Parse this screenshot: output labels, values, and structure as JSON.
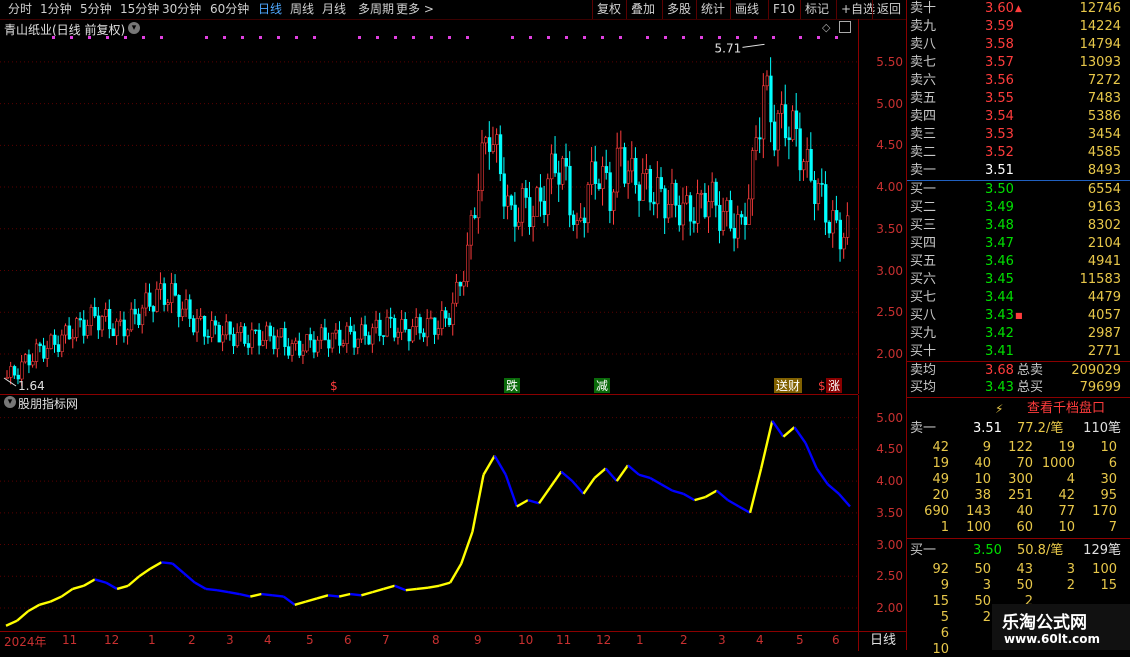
{
  "toolbar": {
    "periods": [
      "分时",
      "1分钟",
      "5分钟",
      "15分钟",
      "30分钟",
      "60分钟",
      "日线",
      "周线",
      "月线",
      "多周期",
      "更多"
    ],
    "active_period": "日线",
    "more_arrow": ">",
    "actions": [
      "复权",
      "叠加",
      "多股",
      "统计",
      "画线",
      "F10",
      "标记",
      "+自选",
      "返回"
    ]
  },
  "main_chart": {
    "title": "青山纸业(日线 前复权)",
    "y_ticks": [
      "5.50",
      "5.00",
      "4.50",
      "4.00",
      "3.50",
      "3.00",
      "2.50",
      "2.00"
    ],
    "high_label": "5.71",
    "low_label": "1.64",
    "event_markers": [
      "$",
      "跌",
      "减",
      "送财",
      "$",
      "涨"
    ]
  },
  "indicator": {
    "title": "股朋指标网",
    "y_ticks": [
      "5.00",
      "4.50",
      "4.00",
      "3.50",
      "3.00",
      "2.50",
      "2.00"
    ]
  },
  "x_axis": {
    "labels": [
      "2024年",
      "11",
      "12",
      "1",
      "2",
      "3",
      "4",
      "5",
      "6",
      "7",
      "8",
      "9",
      "10",
      "11",
      "12",
      "1",
      "2",
      "3",
      "4",
      "5",
      "6"
    ],
    "period_label": "日线"
  },
  "chart_data": [
    {
      "type": "candlestick",
      "title": "青山纸业(日线 前复权)",
      "ylim": [
        1.7,
        5.75
      ],
      "y_ticks": [
        2.0,
        2.5,
        3.0,
        3.5,
        4.0,
        4.5,
        5.0,
        5.5
      ],
      "close_series": [
        1.72,
        1.8,
        1.95,
        2.05,
        2.1,
        2.18,
        2.3,
        2.35,
        2.45,
        2.4,
        2.3,
        2.35,
        2.5,
        2.62,
        2.72,
        2.7,
        2.55,
        2.4,
        2.3,
        2.28,
        2.25,
        2.22,
        2.18,
        2.22,
        2.2,
        2.18,
        2.05,
        2.1,
        2.15,
        2.2,
        2.18,
        2.22,
        2.2,
        2.25,
        2.3,
        2.35,
        2.28,
        2.3,
        2.32,
        2.35,
        2.4,
        2.7,
        3.2,
        4.1,
        4.7,
        4.2,
        3.6,
        3.8,
        3.7,
        3.9,
        4.3,
        4.1,
        3.4,
        4.0,
        4.2,
        3.9,
        4.4,
        4.1,
        4.05,
        3.95,
        3.85,
        3.8,
        3.7,
        3.75,
        3.9,
        3.7,
        3.6,
        3.5,
        4.2,
        5.2,
        4.7,
        4.8,
        4.6,
        4.2,
        3.95,
        3.6,
        3.45
      ],
      "max": 5.71,
      "min": 1.64
    },
    {
      "type": "line",
      "title": "股朋指标网",
      "ylim": [
        1.7,
        5.2
      ],
      "y_ticks": [
        2.0,
        2.5,
        3.0,
        3.5,
        4.0,
        4.5,
        5.0
      ],
      "series": [
        {
          "values": [
            1.72,
            1.8,
            1.95,
            2.05,
            2.1,
            2.18,
            2.3,
            2.35,
            2.45,
            2.4,
            2.3,
            2.35,
            2.5,
            2.62,
            2.72,
            2.7,
            2.55,
            2.4,
            2.3,
            2.28,
            2.25,
            2.22,
            2.18,
            2.22,
            2.2,
            2.18,
            2.05,
            2.1,
            2.15,
            2.2,
            2.18,
            2.22,
            2.2,
            2.25,
            2.3,
            2.35,
            2.28,
            2.3,
            2.32,
            2.35,
            2.4,
            2.7,
            3.2,
            4.1,
            4.4,
            4.1,
            3.6,
            3.7,
            3.65,
            3.9,
            4.15,
            4.0,
            3.8,
            4.05,
            4.2,
            4.0,
            4.25,
            4.1,
            4.05,
            3.95,
            3.85,
            3.8,
            3.7,
            3.75,
            3.85,
            3.7,
            3.6,
            3.5,
            4.2,
            4.95,
            4.7,
            4.85,
            4.6,
            4.2,
            3.95,
            3.8,
            3.6
          ]
        }
      ],
      "colors": {
        "up": "#ffff00",
        "down": "#0000ff"
      }
    }
  ],
  "order_book": {
    "sells": [
      {
        "label": "卖十",
        "price": "3.60",
        "vol": "12746",
        "mark": "▲"
      },
      {
        "label": "卖九",
        "price": "3.59",
        "vol": "14224"
      },
      {
        "label": "卖八",
        "price": "3.58",
        "vol": "14794"
      },
      {
        "label": "卖七",
        "price": "3.57",
        "vol": "13093"
      },
      {
        "label": "卖六",
        "price": "3.56",
        "vol": "7272"
      },
      {
        "label": "卖五",
        "price": "3.55",
        "vol": "7483"
      },
      {
        "label": "卖四",
        "price": "3.54",
        "vol": "5386"
      },
      {
        "label": "卖三",
        "price": "3.53",
        "vol": "3454"
      },
      {
        "label": "卖二",
        "price": "3.52",
        "vol": "4585"
      },
      {
        "label": "卖一",
        "price": "3.51",
        "vol": "8493"
      }
    ],
    "buys": [
      {
        "label": "买一",
        "price": "3.50",
        "vol": "6554"
      },
      {
        "label": "买二",
        "price": "3.49",
        "vol": "9163"
      },
      {
        "label": "买三",
        "price": "3.48",
        "vol": "8302"
      },
      {
        "label": "买四",
        "price": "3.47",
        "vol": "2104"
      },
      {
        "label": "买五",
        "price": "3.46",
        "vol": "4941"
      },
      {
        "label": "买六",
        "price": "3.45",
        "vol": "11583"
      },
      {
        "label": "买七",
        "price": "3.44",
        "vol": "4479"
      },
      {
        "label": "买八",
        "price": "3.43",
        "vol": "4057",
        "mark": "■"
      },
      {
        "label": "买九",
        "price": "3.42",
        "vol": "2987"
      },
      {
        "label": "买十",
        "price": "3.41",
        "vol": "2771"
      }
    ],
    "avg_sell": {
      "label": "卖均",
      "price": "3.68",
      "total_label": "总卖",
      "total": "209029"
    },
    "avg_buy": {
      "label": "买均",
      "price": "3.43",
      "total_label": "总买",
      "total": "79699"
    },
    "link_icon": "lightning-icon",
    "link_text": "查看千档盘口",
    "sell1": {
      "label": "卖一",
      "price": "3.51",
      "avg": "77.2/笔",
      "count": "110笔"
    },
    "sell_grid": [
      [
        "42",
        "9",
        "122",
        "19",
        "10"
      ],
      [
        "19",
        "40",
        "70",
        "1000",
        "6"
      ],
      [
        "49",
        "10",
        "300",
        "4",
        "30"
      ],
      [
        "20",
        "38",
        "251",
        "42",
        "95"
      ],
      [
        "690",
        "143",
        "40",
        "77",
        "170"
      ],
      [
        "1",
        "100",
        "60",
        "10",
        "7"
      ]
    ],
    "buy1": {
      "label": "买一",
      "price": "3.50",
      "avg": "50.8/笔",
      "count": "129笔"
    },
    "buy_grid": [
      [
        "92",
        "50",
        "43",
        "3",
        "100"
      ],
      [
        "9",
        "3",
        "50",
        "2",
        "15"
      ],
      [
        "15",
        "50",
        "2",
        "",
        ""
      ],
      [
        "5",
        "2",
        "",
        "",
        ""
      ],
      [
        "6",
        "",
        "",
        "",
        ""
      ],
      [
        "10",
        "",
        "",
        "",
        ""
      ]
    ]
  },
  "watermark": {
    "title": "乐淘公式网",
    "url": "www.60lt.com"
  },
  "colors": {
    "up": "#ff3c3c",
    "down": "#00ffff",
    "grid": "#5a0000",
    "axis": "#c83030",
    "indicator_up": "#ffff00",
    "indicator_down": "#0000ff"
  }
}
